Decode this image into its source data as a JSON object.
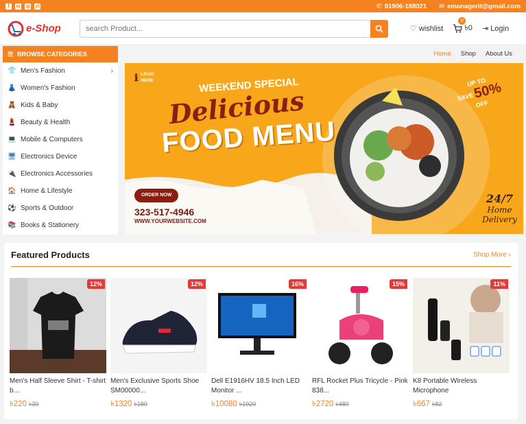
{
  "topbar": {
    "socials": [
      "f",
      "in",
      "ig",
      "yt"
    ],
    "phone": "01906-188021",
    "email": "emanagerit@gmail.com"
  },
  "header": {
    "logo_text": "e-Shop",
    "search_placeholder": "search Product...",
    "wishlist_label": "wishlist",
    "cart_count": "0",
    "cart_total": "৳0",
    "login_label": "Login"
  },
  "categories": {
    "heading": "BROWSE CATEGORIES",
    "items": [
      {
        "label": "Men's Fashion",
        "icon": "shirt-icon",
        "glyph": "👕",
        "has_sub": true
      },
      {
        "label": "Women's Fashion",
        "icon": "dress-icon",
        "glyph": "👗",
        "has_sub": false
      },
      {
        "label": "Kids & Baby",
        "icon": "baby-icon",
        "glyph": "🧸",
        "has_sub": false
      },
      {
        "label": "Beauty & Health",
        "icon": "beauty-icon",
        "glyph": "💄",
        "has_sub": false
      },
      {
        "label": "Mobile & Computers",
        "icon": "laptop-icon",
        "glyph": "💻",
        "has_sub": false
      },
      {
        "label": "Electronics Device",
        "icon": "device-icon",
        "glyph": "🖥",
        "has_sub": false
      },
      {
        "label": "Electronics Accessories",
        "icon": "plug-icon",
        "glyph": "🔌",
        "has_sub": false
      },
      {
        "label": "Home & Lifestyle",
        "icon": "home-icon",
        "glyph": "🏠",
        "has_sub": false
      },
      {
        "label": "Sports & Outdoor",
        "icon": "ball-icon",
        "glyph": "⚽",
        "has_sub": false
      },
      {
        "label": "Books & Stationery",
        "icon": "book-icon",
        "glyph": "📚",
        "has_sub": false
      }
    ]
  },
  "nav": [
    "Home",
    "Shop",
    "About Us"
  ],
  "banner": {
    "logo_line1": "LOGO",
    "logo_line2": "HERE",
    "weekend": "WEEKEND SPECIAL",
    "delicious": "Delicious",
    "food_menu": "FOOD MENU",
    "order_now": "ORDER NOW",
    "phone": "323-517-4946",
    "website": "WWW.YOURWEBSITE.COM",
    "up_to": "UP TO",
    "save": "SAVE",
    "percent": "50%",
    "off": "OFF",
    "delivery_line1": "24/7",
    "delivery_line2": "Home Delivery"
  },
  "featured": {
    "title": "Featured Products",
    "shop_more": "Shop More",
    "products": [
      {
        "name": "Men's Half Sleeve Shirt - T-shirt b...",
        "discount": "12%",
        "price": "৳220",
        "old_price": "৳30"
      },
      {
        "name": "Men's Exclusive Sports Shoe SM00000...",
        "discount": "12%",
        "price": "৳1320",
        "old_price": "৳180"
      },
      {
        "name": "Dell E1916HV 18.5 Inch LED Monitor ...",
        "discount": "16%",
        "price": "৳10080",
        "old_price": "৳1920"
      },
      {
        "name": "RFL Rocket Plus Tricycle - Pink 838...",
        "discount": "15%",
        "price": "৳2720",
        "old_price": "৳480"
      },
      {
        "name": "K8 Portable Wireless Microphone",
        "discount": "11%",
        "price": "৳667",
        "old_price": "৳82"
      }
    ]
  },
  "colors": {
    "accent": "#f58220",
    "discount": "#e53935"
  }
}
